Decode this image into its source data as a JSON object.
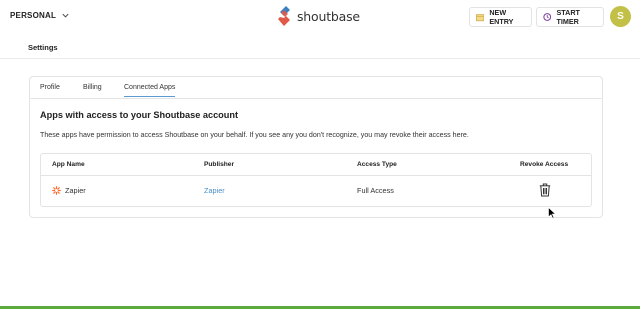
{
  "header": {
    "workspace_label": "PERSONAL",
    "logo_text": "shoutbase",
    "new_entry_label": "NEW ENTRY",
    "start_timer_label": "START TIMER",
    "avatar_initial": "S"
  },
  "page": {
    "title": "Settings"
  },
  "tabs": [
    {
      "label": "Profile",
      "active": false
    },
    {
      "label": "Billing",
      "active": false
    },
    {
      "label": "Connected Apps",
      "active": true
    }
  ],
  "connected_apps": {
    "title": "Apps with access to your Shoutbase account",
    "description": "These apps have permission to access Shoutbase on your behalf. If you see any you don't recognize, you may revoke their access here.",
    "columns": [
      "App Name",
      "Publisher",
      "Access Type",
      "Revoke Access"
    ],
    "rows": [
      {
        "app_name": "Zapier",
        "publisher": "Zapier",
        "access_type": "Full Access"
      }
    ]
  },
  "colors": {
    "avatar": "#c2c046",
    "link": "#4a90c8",
    "active_tab": "#5a9bd5",
    "bottom_bar": "#5aaa3c"
  }
}
